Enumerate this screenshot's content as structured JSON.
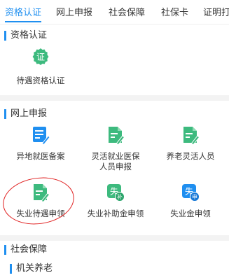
{
  "tabs": [
    "资格认证",
    "网上申报",
    "社会保障",
    "社保卡",
    "证明打"
  ],
  "sections": {
    "qualification": {
      "title": "资格认证",
      "items": [
        {
          "label": "待遇资格认证",
          "icon": "certificate-icon"
        }
      ]
    },
    "online_declaration": {
      "title": "网上申报",
      "items": [
        {
          "label": "异地就医备案",
          "icon": "form-edit-icon"
        },
        {
          "label": "灵活就业医保人员申报",
          "icon": "document-edit-icon"
        },
        {
          "label": "养老灵活人员",
          "icon": "document-edit-icon"
        },
        {
          "label": "失业待遇申领",
          "icon": "document-edit-icon"
        },
        {
          "label": "失业补助金申领",
          "icon": "unemployment-subsidy-icon"
        },
        {
          "label": "失业金申领",
          "icon": "unemployment-apply-icon"
        }
      ]
    },
    "social_security": {
      "title": "社会保障",
      "subsection": "机关养老"
    }
  },
  "icon_glyphs": {
    "certificate": "证",
    "unemployment_main": "失",
    "subsidy": "补",
    "apply": "申"
  },
  "colors": {
    "accent": "#1f8ff0",
    "green": "#3dba7e",
    "annotation": "#e02020"
  }
}
